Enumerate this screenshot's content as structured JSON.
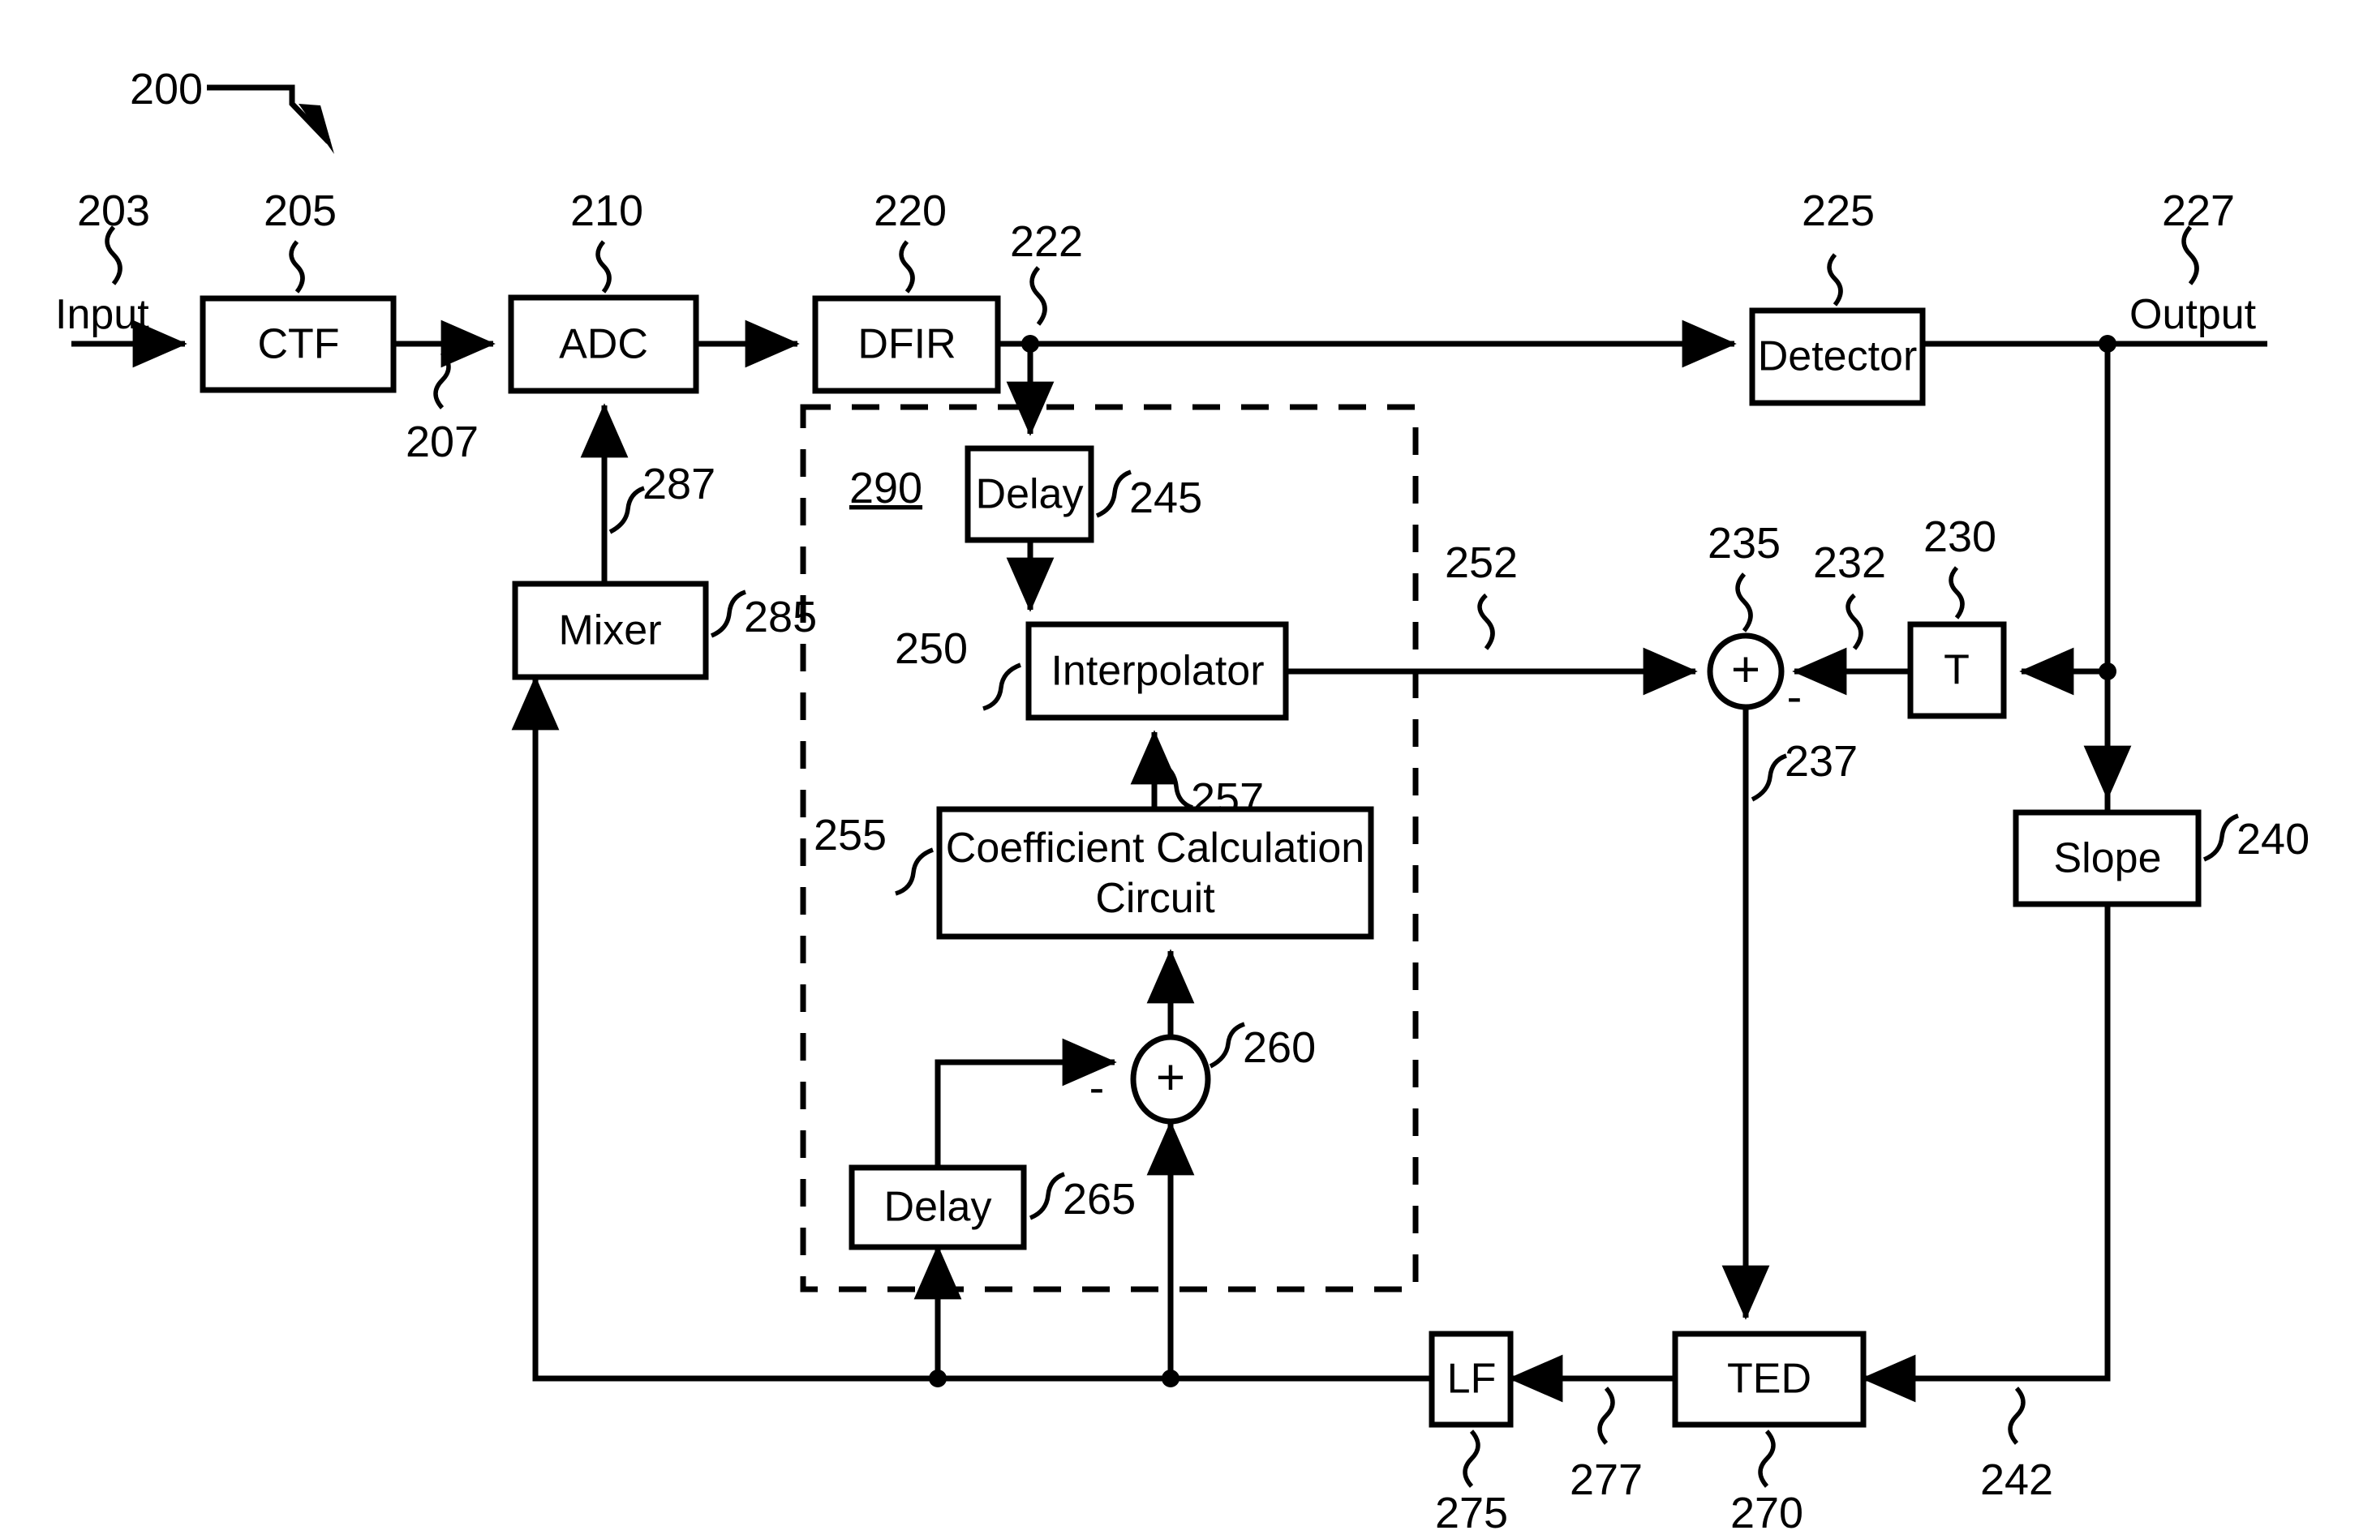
{
  "figure": {
    "number": "200",
    "dashed_group_ref": "290"
  },
  "ports": {
    "input_label": "Input",
    "input_ref": "203",
    "output_label": "Output",
    "output_ref": "227"
  },
  "blocks": [
    {
      "id": "ctf",
      "label": "CTF",
      "ref": "205"
    },
    {
      "id": "adc",
      "label": "ADC",
      "ref": "210"
    },
    {
      "id": "dfir",
      "label": "DFIR",
      "ref": "220"
    },
    {
      "id": "detector",
      "label": "Detector",
      "ref": "225"
    },
    {
      "id": "delay245",
      "label": "Delay",
      "ref": "245"
    },
    {
      "id": "interp",
      "label": "Interpolator",
      "ref": "250"
    },
    {
      "id": "coeff",
      "label_line1": "Coefficient Calculation",
      "label_line2": "Circuit",
      "ref": "255"
    },
    {
      "id": "delay265",
      "label": "Delay",
      "ref": "265"
    },
    {
      "id": "mixer",
      "label": "Mixer",
      "ref": "285"
    },
    {
      "id": "tblock",
      "label": "T",
      "ref": "230"
    },
    {
      "id": "slope",
      "label": "Slope",
      "ref": "240"
    },
    {
      "id": "ted",
      "label": "TED",
      "ref": "270"
    },
    {
      "id": "lf",
      "label": "LF",
      "ref": "275"
    }
  ],
  "summing_nodes": [
    {
      "id": "sum235",
      "symbol": "+",
      "minus_sign": "-",
      "ref": "235"
    },
    {
      "id": "sum260",
      "symbol": "+",
      "minus_sign": "-",
      "ref": "260"
    }
  ],
  "signal_refs": [
    {
      "id": "sig207",
      "ref": "207"
    },
    {
      "id": "sig222",
      "ref": "222"
    },
    {
      "id": "sig232",
      "ref": "232"
    },
    {
      "id": "sig237",
      "ref": "237"
    },
    {
      "id": "sig242",
      "ref": "242"
    },
    {
      "id": "sig252",
      "ref": "252"
    },
    {
      "id": "sig257",
      "ref": "257"
    },
    {
      "id": "sig277",
      "ref": "277"
    },
    {
      "id": "sig287",
      "ref": "287"
    }
  ],
  "colors": {
    "line": "#000000",
    "background": "#ffffff"
  }
}
